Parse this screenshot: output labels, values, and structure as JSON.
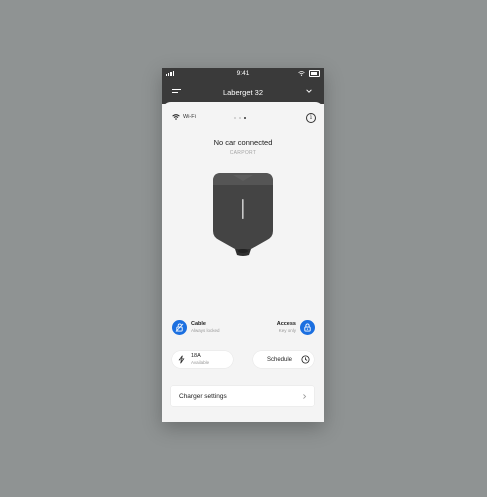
{
  "status_bar": {
    "time": "9:41"
  },
  "header": {
    "title": "Laberget 32"
  },
  "connection": {
    "label": "Wi-Fi",
    "pages": 3,
    "active_page": 3
  },
  "charger": {
    "status": "No car connected",
    "location": "CARPORT"
  },
  "quick_actions": {
    "cable": {
      "label": "Cable",
      "sub": "Always locked"
    },
    "access": {
      "label": "Access",
      "sub": "Key only"
    },
    "current": {
      "label": "18A",
      "sub": "Available"
    },
    "schedule": {
      "label": "Schedule"
    }
  },
  "settings": {
    "label": "Charger settings"
  },
  "colors": {
    "accent": "#1b6fe0",
    "header_bg": "#3a3a3a",
    "background": "#8f9393"
  },
  "icons": [
    "signal-icon",
    "wifi-icon",
    "battery-icon",
    "menu-icon",
    "chevron-down-icon",
    "info-icon",
    "unlock-icon",
    "lock-icon",
    "bolt-icon",
    "clock-icon",
    "chevron-right-icon"
  ]
}
